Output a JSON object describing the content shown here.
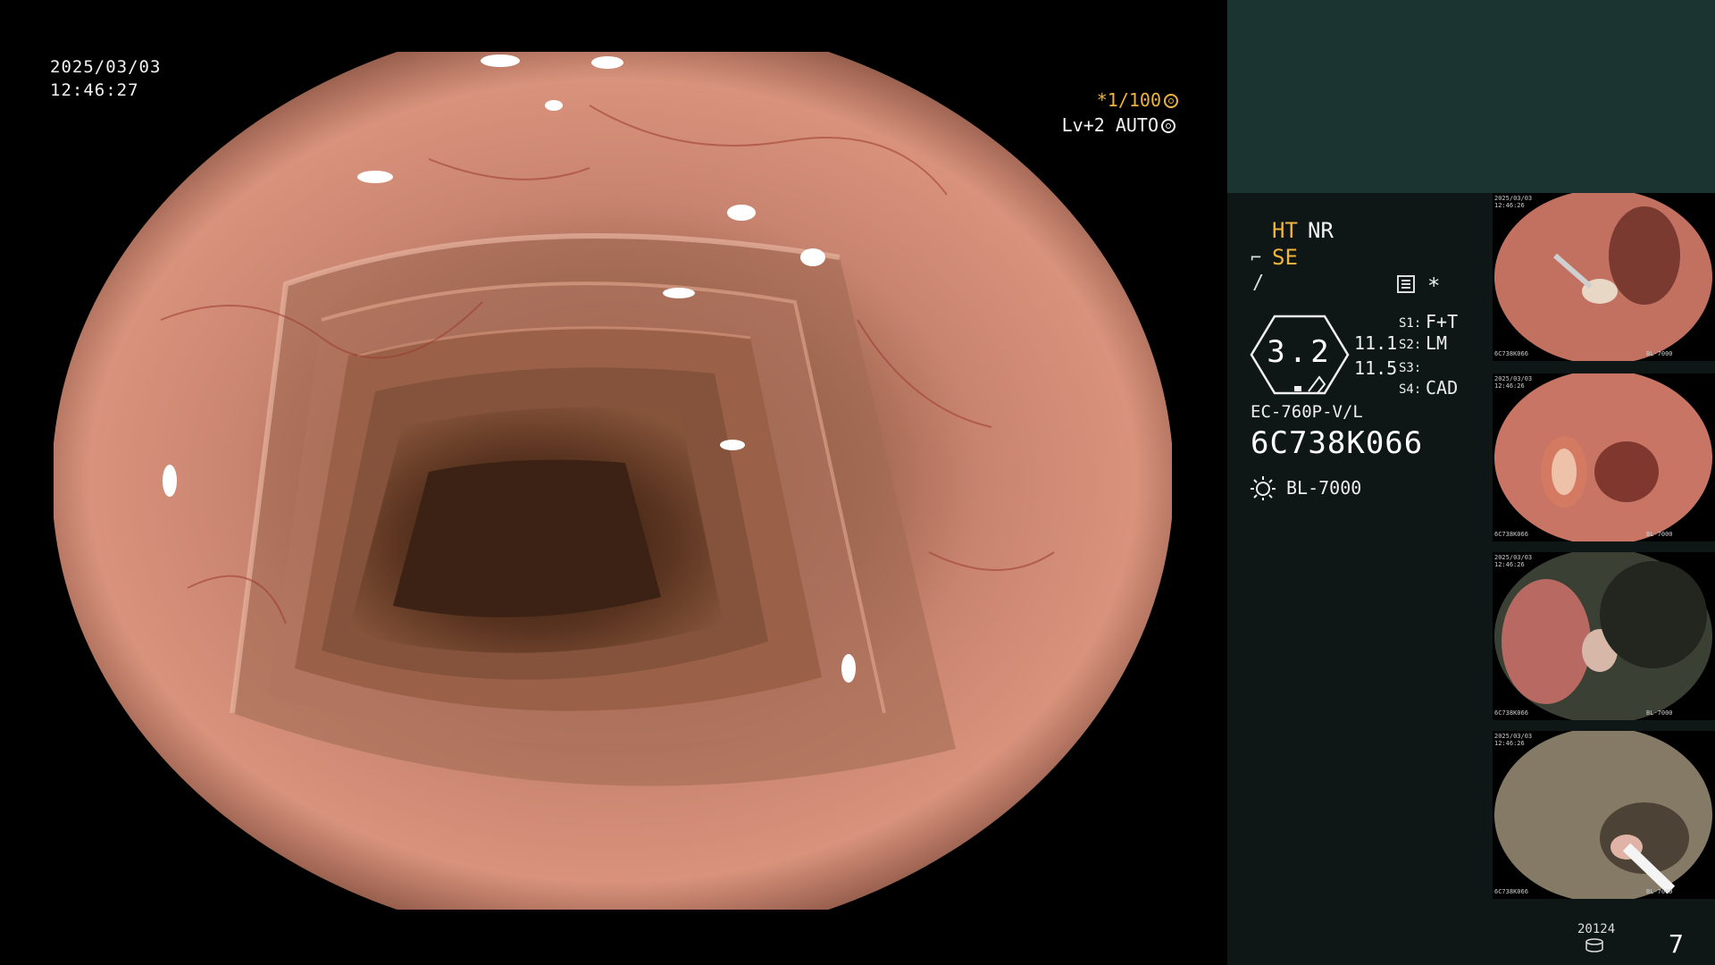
{
  "overlay": {
    "date": "2025/03/03",
    "time": "12:46:27",
    "shutter": "*1/100",
    "shutter_icon": "aperture-icon",
    "level": "Lv+2 AUTO",
    "level_icon": "auto-iris-icon"
  },
  "settings": {
    "ht": "HT",
    "nr": "NR",
    "se": "SE",
    "hex_value": "3.2",
    "value_top": "11.1",
    "value_bottom": "11.5",
    "s1_label": "S1:",
    "s1_value": "F+T",
    "s2_label": "S2:",
    "s2_value": "LM",
    "s3_label": "S3:",
    "s4_label": "S4:",
    "s4_value": "CAD",
    "star": "*",
    "model": "EC-760P-V/L",
    "serial": "6C738K066",
    "light_source": "BL-7000"
  },
  "thumbnails": [
    {
      "date": "2025/03/03",
      "time": "12:46:26",
      "serial": "6C738K066",
      "light": "BL-7000"
    },
    {
      "date": "2025/03/03",
      "time": "12:46:26",
      "serial": "6C738K066",
      "light": "BL-7000"
    },
    {
      "date": "2025/03/03",
      "time": "12:46:26",
      "serial": "6C738K066",
      "light": "BL-7000"
    },
    {
      "date": "2025/03/03",
      "time": "12:46:26",
      "serial": "6C738K066",
      "light": "BL-7000"
    }
  ],
  "footer": {
    "counter": "20124",
    "page": "7"
  },
  "colors": {
    "accent": "#f0b43c",
    "panel_bg": "#0e1616",
    "panel_top": "#1b3432",
    "mucosa": "#c98470"
  }
}
